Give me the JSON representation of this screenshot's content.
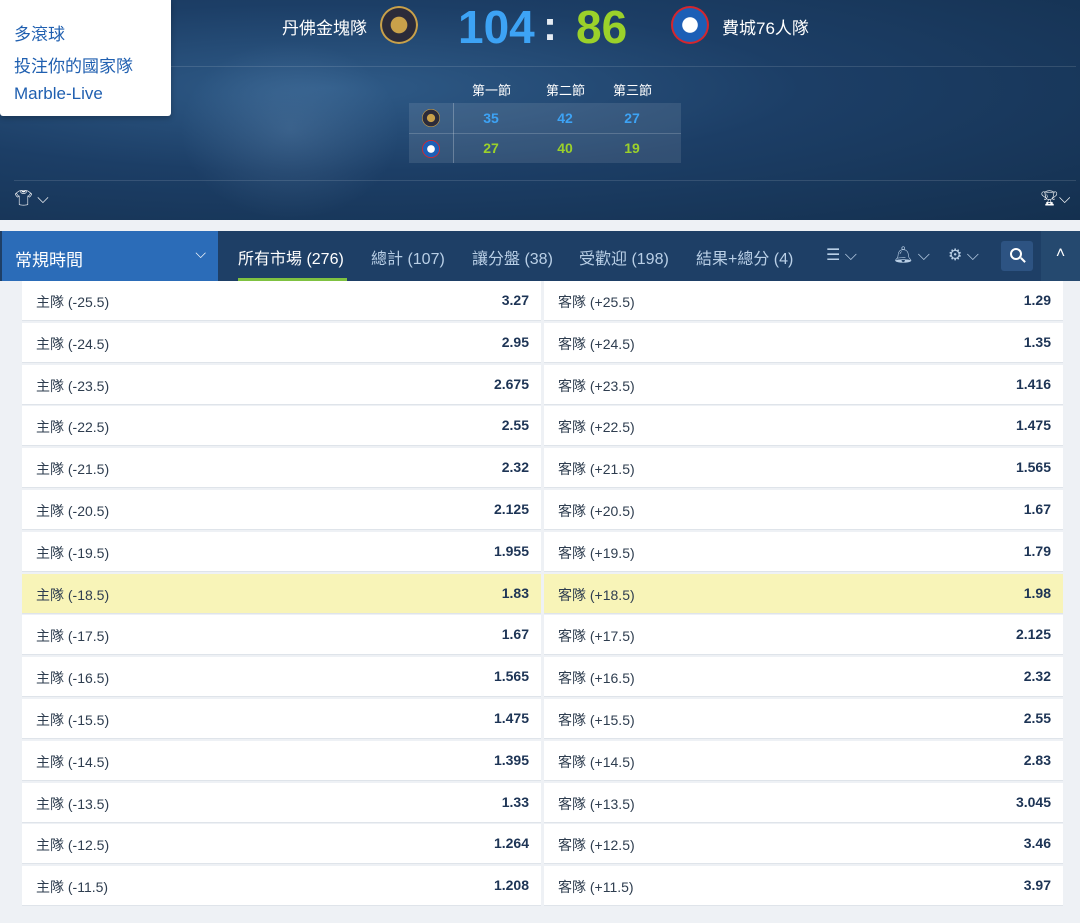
{
  "match": {
    "home_team": "丹佛金塊隊",
    "away_team": "費城76人隊",
    "home_score": "104",
    "separator": ":",
    "away_score": "86",
    "periods": [
      {
        "label": "第一節",
        "home": "35",
        "away": "27"
      },
      {
        "label": "第二節",
        "home": "42",
        "away": "40"
      },
      {
        "label": "第三節",
        "home": "27",
        "away": "19"
      }
    ],
    "colors": {
      "home_score": "#3da3f5",
      "away_score": "#9bd12a"
    }
  },
  "dropdown": {
    "items": [
      "多滾球",
      "投注你的國家隊",
      "Marble-Live"
    ]
  },
  "market_bar": {
    "period_select": "常規時間",
    "tabs": [
      {
        "label": "所有市場 (276)",
        "active": true
      },
      {
        "label": "總計 (107)",
        "active": false
      },
      {
        "label": "讓分盤 (38)",
        "active": false
      },
      {
        "label": "受歡迎 (198)",
        "active": false
      },
      {
        "label": "結果+總分 (4)",
        "active": false
      }
    ],
    "icons": [
      "list-icon",
      "bell-icon",
      "gear-icon",
      "search-icon",
      "collapse-up-icon"
    ]
  },
  "odds": [
    {
      "home": "主隊 (-25.5)",
      "home_odd": "3.27",
      "away": "客隊 (+25.5)",
      "away_odd": "1.29"
    },
    {
      "home": "主隊 (-24.5)",
      "home_odd": "2.95",
      "away": "客隊 (+24.5)",
      "away_odd": "1.35"
    },
    {
      "home": "主隊 (-23.5)",
      "home_odd": "2.675",
      "away": "客隊 (+23.5)",
      "away_odd": "1.416"
    },
    {
      "home": "主隊 (-22.5)",
      "home_odd": "2.55",
      "away": "客隊 (+22.5)",
      "away_odd": "1.475"
    },
    {
      "home": "主隊 (-21.5)",
      "home_odd": "2.32",
      "away": "客隊 (+21.5)",
      "away_odd": "1.565"
    },
    {
      "home": "主隊 (-20.5)",
      "home_odd": "2.125",
      "away": "客隊 (+20.5)",
      "away_odd": "1.67"
    },
    {
      "home": "主隊 (-19.5)",
      "home_odd": "1.955",
      "away": "客隊 (+19.5)",
      "away_odd": "1.79"
    },
    {
      "home": "主隊 (-18.5)",
      "home_odd": "1.83",
      "away": "客隊 (+18.5)",
      "away_odd": "1.98",
      "highlight": true
    },
    {
      "home": "主隊 (-17.5)",
      "home_odd": "1.67",
      "away": "客隊 (+17.5)",
      "away_odd": "2.125"
    },
    {
      "home": "主隊 (-16.5)",
      "home_odd": "1.565",
      "away": "客隊 (+16.5)",
      "away_odd": "2.32"
    },
    {
      "home": "主隊 (-15.5)",
      "home_odd": "1.475",
      "away": "客隊 (+15.5)",
      "away_odd": "2.55"
    },
    {
      "home": "主隊 (-14.5)",
      "home_odd": "1.395",
      "away": "客隊 (+14.5)",
      "away_odd": "2.83"
    },
    {
      "home": "主隊 (-13.5)",
      "home_odd": "1.33",
      "away": "客隊 (+13.5)",
      "away_odd": "3.045"
    },
    {
      "home": "主隊 (-12.5)",
      "home_odd": "1.264",
      "away": "客隊 (+12.5)",
      "away_odd": "3.46"
    },
    {
      "home": "主隊 (-11.5)",
      "home_odd": "1.208",
      "away": "客隊 (+11.5)",
      "away_odd": "3.97"
    }
  ]
}
